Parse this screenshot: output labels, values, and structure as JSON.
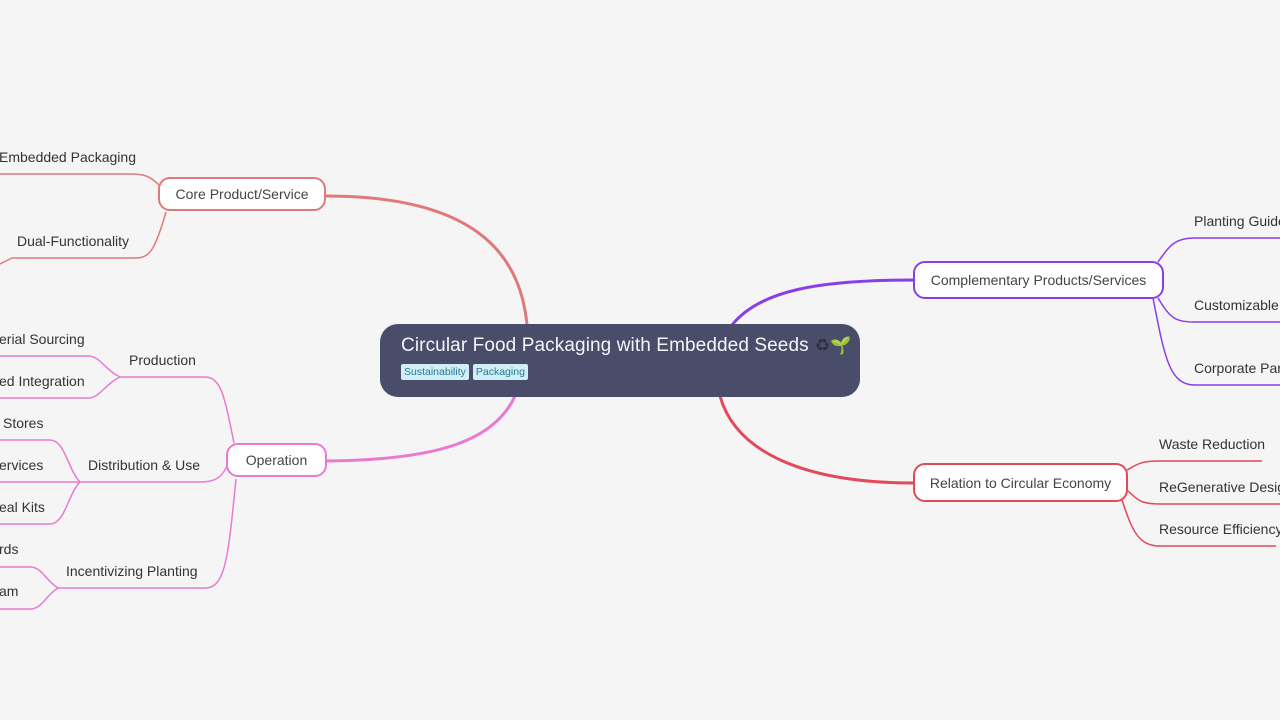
{
  "root": {
    "title": "Circular Food Packaging with Embedded Seeds",
    "emoji_recycle": "♻",
    "emoji_sprout": "🌱",
    "tags": [
      "Sustainability",
      "Packaging"
    ]
  },
  "colors": {
    "core": "#e07a7a",
    "operation": "#e87ad0",
    "complementary": "#8a3ee8",
    "circular": "#e04a5a",
    "root_bg": "#4a4d6a"
  },
  "branches": {
    "core": {
      "label": "Core Product/Service",
      "children": [
        "Embedded Packaging",
        "Dual-Functionality"
      ]
    },
    "operation": {
      "label": "Operation",
      "children": [
        {
          "label": "Production",
          "children": [
            "erial Sourcing",
            "ed Integration"
          ]
        },
        {
          "label": "Distribution & Use",
          "children": [
            "Stores",
            "ervices",
            "eal Kits"
          ]
        },
        {
          "label": "Incentivizing Planting",
          "children": [
            "rds",
            "am"
          ]
        }
      ]
    },
    "complementary": {
      "label": "Complementary Products/Services",
      "children": [
        "Planting Guide",
        "Customizable S",
        "Corporate Part"
      ]
    },
    "circular": {
      "label": "Relation to Circular Economy",
      "children": [
        "Waste Reduction",
        "ReGenerative Design",
        "Resource Efficiency"
      ]
    }
  }
}
